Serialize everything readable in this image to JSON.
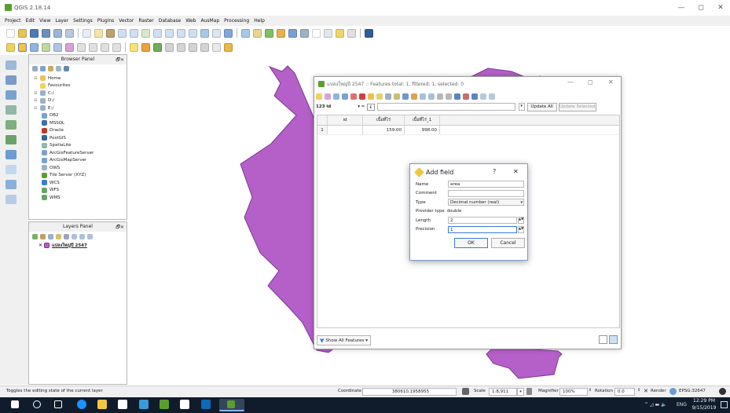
{
  "window": {
    "title": "QGIS 2.18.14",
    "min": "—",
    "max": "◻",
    "close": "✕"
  },
  "menu": [
    "Project",
    "Edit",
    "View",
    "Layer",
    "Settings",
    "Plugins",
    "Vector",
    "Raster",
    "Database",
    "Web",
    "AusMap",
    "Processing",
    "Help"
  ],
  "browser_panel": {
    "title": "Browser Panel",
    "controls": "🗗✕",
    "items": [
      {
        "label": "Home",
        "icon": "folder-icon",
        "expand": "⊞",
        "indent": 1
      },
      {
        "label": "Favourites",
        "icon": "star-icon",
        "expand": "",
        "indent": 1
      },
      {
        "label": "C:/",
        "icon": "drive-icon",
        "expand": "⊞",
        "indent": 1
      },
      {
        "label": "D:/",
        "icon": "drive-icon",
        "expand": "⊞",
        "indent": 1
      },
      {
        "label": "E:/",
        "icon": "drive-icon",
        "expand": "⊞",
        "indent": 1
      },
      {
        "label": "DB2",
        "icon": "db2-icon",
        "expand": "",
        "indent": 0
      },
      {
        "label": "MSSQL",
        "icon": "mssql-icon",
        "expand": "",
        "indent": 0
      },
      {
        "label": "Oracle",
        "icon": "oracle-icon",
        "expand": "",
        "indent": 0
      },
      {
        "label": "PostGIS",
        "icon": "postgis-icon",
        "expand": "",
        "indent": 0
      },
      {
        "label": "SpatiaLite",
        "icon": "spatialite-icon",
        "expand": "",
        "indent": 0
      },
      {
        "label": "ArcGisFeatureServer",
        "icon": "arcgis-feature-icon",
        "expand": "",
        "indent": 0
      },
      {
        "label": "ArcGisMapServer",
        "icon": "arcgis-map-icon",
        "expand": "",
        "indent": 0
      },
      {
        "label": "OWS",
        "icon": "ows-icon",
        "expand": "",
        "indent": 0
      },
      {
        "label": "Tile Server (XYZ)",
        "icon": "xyz-icon",
        "expand": "",
        "indent": 0
      },
      {
        "label": "WCS",
        "icon": "wcs-icon",
        "expand": "",
        "indent": 0
      },
      {
        "label": "WFS",
        "icon": "wfs-icon",
        "expand": "",
        "indent": 0
      },
      {
        "label": "WMS",
        "icon": "wms-icon",
        "expand": "",
        "indent": 0
      }
    ]
  },
  "layers_panel": {
    "title": "Layers Panel",
    "controls": "🗗✕",
    "layer": {
      "checked": "✕",
      "label": "แปลงใหญ่ปี 2547"
    }
  },
  "attribute_table": {
    "title": "แปลงใหญ่ปี 2547 :: Features total: 1, filtered: 1, selected: 0",
    "field_select": "123 id",
    "equals": "▾ =",
    "expr_icon": "ε",
    "update_all": "Update All",
    "update_selected": "Update Selected",
    "columns": [
      "id",
      "เนื้อที่ไร่",
      "เนื้อที่ไร่_1"
    ],
    "rows": [
      [
        "1",
        "",
        "159.00",
        "998.00"
      ]
    ],
    "show_all": "Show All Features",
    "show_all_arrow": "▾"
  },
  "add_field": {
    "title": "Add field",
    "help": "?",
    "close": "✕",
    "name_label": "Name",
    "name_value": "area",
    "comment_label": "Comment",
    "comment_value": "",
    "type_label": "Type",
    "type_value": "Decimal number (real)",
    "provider_type_label": "Provider type",
    "provider_type_value": "double",
    "length_label": "Length",
    "length_value": "2",
    "precision_label": "Precision",
    "precision_value": "1",
    "ok": "OK",
    "cancel": "Cancel"
  },
  "status": {
    "message": "Toggles the editing state of the current layer",
    "coordinate_label": "Coordinate",
    "coordinate_value": "380610,1958955",
    "scale_label": "Scale",
    "scale_value": "1:8,911",
    "magnifier_label": "Magnifier",
    "magnifier_value": "100%",
    "rotation_label": "Rotation",
    "rotation_value": "0.0",
    "render_label": "Render",
    "crs": "EPSG:32647"
  },
  "taskbar": {
    "time": "12:29 PM",
    "date": "9/15/2019",
    "lang": "ENG",
    "tray": "^ ◿ ▬ 🔈"
  },
  "colors": {
    "polygon": "#b55fc9",
    "polygon_stroke": "#7a3a8f",
    "accent": "#3a7bd5"
  }
}
